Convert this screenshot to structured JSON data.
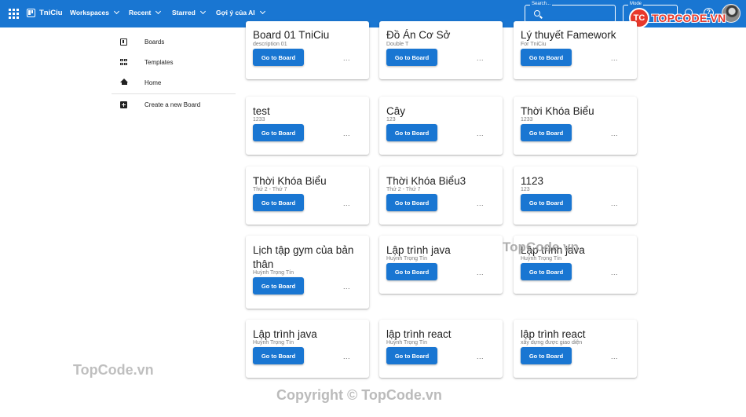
{
  "topbar": {
    "brand": "TniCiu",
    "menus": [
      {
        "label": "Workspaces"
      },
      {
        "label": "Recent"
      },
      {
        "label": "Starred"
      },
      {
        "label": "Gợi ý của AI"
      }
    ],
    "search_label": "Search...",
    "search_value": "",
    "mode_label": "Mode",
    "mode_value": "",
    "avatar_icon": "user-avatar",
    "colors": {
      "bar": "#1976d2",
      "button": "#1976d2"
    }
  },
  "watermark_brand": {
    "icon_text": "TC",
    "text": "TOPCODE.VN"
  },
  "sidebar": {
    "items": [
      {
        "label": "Boards",
        "icon": "board-icon"
      },
      {
        "label": "Templates",
        "icon": "templates-icon"
      },
      {
        "label": "Home",
        "icon": "home-icon"
      },
      {
        "label": "Create a new Board",
        "icon": "add-box-icon"
      }
    ]
  },
  "boards": [
    {
      "title": "Board 01 TniCiu",
      "description": "description 01",
      "button": "Go to Board",
      "more": "..."
    },
    {
      "title": "Đồ Án Cơ Sở",
      "description": "Double T",
      "button": "Go to Board",
      "more": "..."
    },
    {
      "title": "Lý thuyết Famework",
      "description": "For TniCiu",
      "button": "Go to Board",
      "more": "..."
    },
    {
      "title": "test",
      "description": "1233",
      "button": "Go to Board",
      "more": "..."
    },
    {
      "title": "Cây",
      "description": "123",
      "button": "Go to Board",
      "more": "..."
    },
    {
      "title": "Thời Khóa Biểu",
      "description": "1233",
      "button": "Go to Board",
      "more": "..."
    },
    {
      "title": "Thời Khóa Biểu",
      "description": "Thứ 2 - Thứ 7",
      "button": "Go to Board",
      "more": "..."
    },
    {
      "title": "Thời Khóa Biểu3",
      "description": "Thứ 2 - Thứ 7",
      "button": "Go to Board",
      "more": "..."
    },
    {
      "title": "1123",
      "description": "123",
      "button": "Go to Board",
      "more": "..."
    },
    {
      "title": "Lịch tập gym của bản thân",
      "description": "Huỳnh Trọng Tín",
      "button": "Go to Board",
      "more": "..."
    },
    {
      "title": "Lập trình java",
      "description": "Huỳnh Trọng Tín",
      "button": "Go to Board",
      "more": "..."
    },
    {
      "title": "Lập trình java",
      "description": "Huỳnh Trọng Tín",
      "button": "Go to Board",
      "more": "..."
    },
    {
      "title": "Lập trình java",
      "description": "Huỳnh Trọng Tín",
      "button": "Go to Board",
      "more": "..."
    },
    {
      "title": "lập trình react",
      "description": "Huỳnh Trọng Tín",
      "button": "Go to Board",
      "more": "..."
    },
    {
      "title": "lập trình react",
      "description": "xây dựng được giao diện",
      "button": "Go to Board",
      "more": "..."
    }
  ],
  "watermarks": {
    "center": "TopCode.vn",
    "left": "TopCode.vn",
    "bottom": "Copyright © TopCode.vn"
  }
}
